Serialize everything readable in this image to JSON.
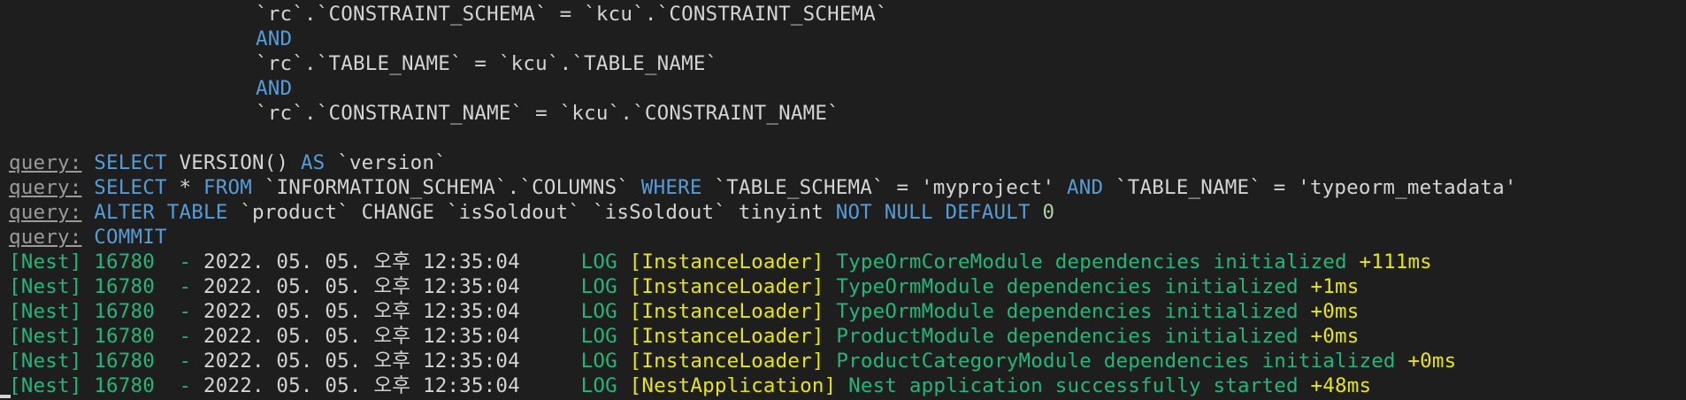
{
  "terminal": {
    "sql_tail": [
      {
        "text": "`rc`.`CONSTRAINT_SCHEMA` = `kcu`.`CONSTRAINT_SCHEMA`"
      },
      {
        "text": "AND"
      },
      {
        "text": "`rc`.`TABLE_NAME` = `kcu`.`TABLE_NAME`"
      },
      {
        "text": "AND"
      },
      {
        "text": "`rc`.`CONSTRAINT_NAME` = `kcu`.`CONSTRAINT_NAME`"
      }
    ],
    "query_prefix": "query:",
    "queries": [
      {
        "q1_kw1": "SELECT",
        "q1_mid": " VERSION() ",
        "q1_kw2": "AS",
        "q1_tail": " `version`"
      },
      {
        "q2_kw1": "SELECT",
        "q2_a": " * ",
        "q2_kw2": "FROM",
        "q2_b": " `INFORMATION_SCHEMA`.`COLUMNS` ",
        "q2_kw3": "WHERE",
        "q2_c": " `TABLE_SCHEMA` = 'myproject' ",
        "q2_kw4": "AND",
        "q2_d": " `TABLE_NAME` = 'typeorm_metadata'"
      },
      {
        "q3_kw1": "ALTER TABLE",
        "q3_a": " `product` CHANGE `isSoldout` `isSoldout` tinyint ",
        "q3_kw2": "NOT NULL DEFAULT",
        "q3_sp": " ",
        "q3_num": "0"
      },
      {
        "q4_kw1": "COMMIT"
      }
    ],
    "logs": [
      {
        "prefix": "[Nest] 16780  - ",
        "timestamp": "2022. 05. 05. 오후 12:35:04",
        "level": "LOG",
        "context": "[InstanceLoader]",
        "message": "TypeOrmCoreModule dependencies initialized",
        "elapsed": "+111ms"
      },
      {
        "prefix": "[Nest] 16780  - ",
        "timestamp": "2022. 05. 05. 오후 12:35:04",
        "level": "LOG",
        "context": "[InstanceLoader]",
        "message": "TypeOrmModule dependencies initialized",
        "elapsed": "+1ms"
      },
      {
        "prefix": "[Nest] 16780  - ",
        "timestamp": "2022. 05. 05. 오후 12:35:04",
        "level": "LOG",
        "context": "[InstanceLoader]",
        "message": "TypeOrmModule dependencies initialized",
        "elapsed": "+0ms"
      },
      {
        "prefix": "[Nest] 16780  - ",
        "timestamp": "2022. 05. 05. 오후 12:35:04",
        "level": "LOG",
        "context": "[InstanceLoader]",
        "message": "ProductModule dependencies initialized",
        "elapsed": "+0ms"
      },
      {
        "prefix": "[Nest] 16780  - ",
        "timestamp": "2022. 05. 05. 오후 12:35:04",
        "level": "LOG",
        "context": "[InstanceLoader]",
        "message": "ProductCategoryModule dependencies initialized",
        "elapsed": "+0ms"
      },
      {
        "prefix": "[Nest] 16780  - ",
        "timestamp": "2022. 05. 05. 오후 12:35:04",
        "level": "LOG",
        "context": "[NestApplication]",
        "message": "Nest application successfully started",
        "elapsed": "+48ms"
      }
    ]
  },
  "colors": {
    "background": "#1e1e1e",
    "foreground": "#d4d4d4",
    "keyword": "#569cd6",
    "number": "#b5cea8",
    "log_green": "#23b67a",
    "log_yellow": "#e5e510",
    "label_gray": "#9a9a9a"
  }
}
